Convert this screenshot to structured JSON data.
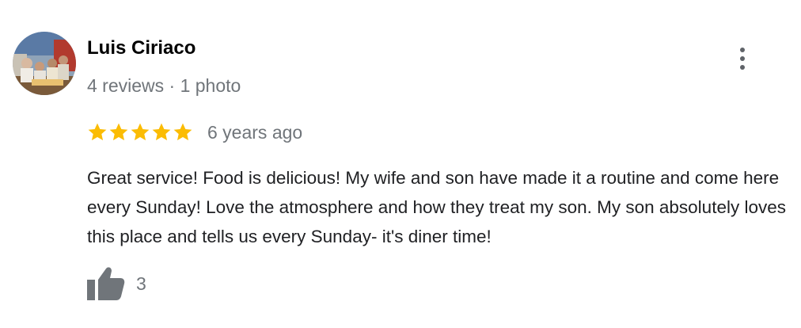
{
  "review": {
    "author": {
      "name": "Luis Ciriaco",
      "meta": "4 reviews · 1 photo",
      "avatar_icon": "profile-photo"
    },
    "menu_icon": "more-vert-icon",
    "rating": {
      "stars": 5,
      "max_stars": 5,
      "star_color": "#fbbc04",
      "star_icon": "star-icon"
    },
    "date": "6 years ago",
    "text": "Great service! Food is delicious! My wife and son have made it a routine and come here every Sunday! Love the atmosphere and how they treat my son. My son absolutely loves this place and tells us every Sunday- it's diner time!",
    "likes": {
      "icon": "thumbs-up-icon",
      "count": "3",
      "icon_color": "#70757a"
    }
  }
}
